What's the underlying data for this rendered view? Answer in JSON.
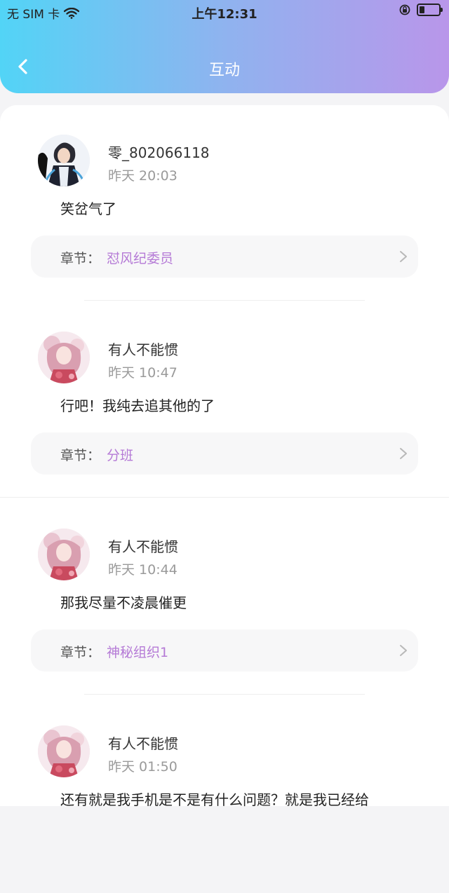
{
  "status_bar": {
    "carrier": "无 SIM 卡",
    "time": "上午12:31",
    "battery_level": 0.25
  },
  "nav": {
    "title": "互动",
    "back_icon": "chevron-left-icon"
  },
  "comments": [
    {
      "username": "零_802066118",
      "time": "昨天 20:03",
      "text": "笑岔气了",
      "chapter_label": "章节：",
      "chapter_name": "怼风纪委员",
      "avatar": "anime-boy-avatar"
    },
    {
      "username": "有人不能惯",
      "time": "昨天 10:47",
      "text": "行吧！我纯去追其他的了",
      "chapter_label": "章节：",
      "chapter_name": "分班",
      "avatar": "anime-girl-avatar"
    },
    {
      "username": "有人不能惯",
      "time": "昨天 10:44",
      "text": "那我尽量不凌晨催更",
      "chapter_label": "章节：",
      "chapter_name": "神秘组织1",
      "avatar": "anime-girl-avatar"
    },
    {
      "username": "有人不能惯",
      "time": "昨天 01:50",
      "text": "还有就是我手机是不是有什么问题？就是我已经给",
      "avatar": "anime-girl-avatar"
    }
  ],
  "colors": {
    "header_gradient_start": "#52d4f6",
    "header_gradient_end": "#b996ea",
    "chapter_link": "#b57ad6"
  }
}
